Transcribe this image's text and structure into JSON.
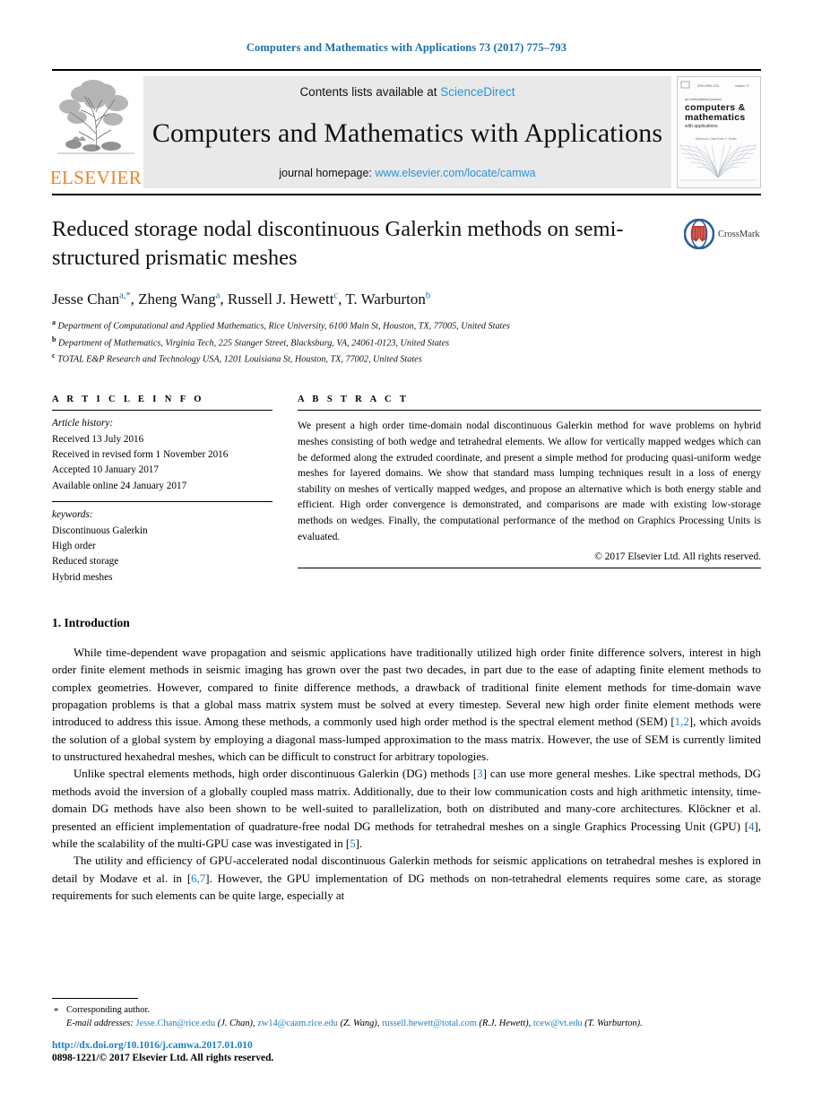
{
  "running_head": "Computers and Mathematics with Applications 73 (2017) 775–793",
  "masthead": {
    "publisher_name": "ELSEVIER",
    "contents_prefix": "Contents lists available at ",
    "contents_link": "ScienceDirect",
    "journal_title": "Computers and Mathematics with Applications",
    "homepage_prefix": "journal homepage: ",
    "homepage_url": "www.elsevier.com/locate/camwa",
    "cover": {
      "line1": "an international journal",
      "line2": "computers &",
      "line3": "mathematics",
      "line4": "with applications",
      "editors": "Editors-in-Chief  Ervin Y. Rodin"
    }
  },
  "article": {
    "title": "Reduced storage nodal discontinuous Galerkin methods on semi-structured prismatic meshes",
    "crossmark_label": "CrossMark",
    "authors": [
      {
        "name": "Jesse Chan",
        "marks": "a,*"
      },
      {
        "name": "Zheng Wang",
        "marks": "a"
      },
      {
        "name": "Russell J. Hewett",
        "marks": "c"
      },
      {
        "name": "T. Warburton",
        "marks": "b"
      }
    ],
    "affiliations": [
      {
        "mark": "a",
        "text": "Department of Computational and Applied Mathematics, Rice University, 6100 Main St, Houston, TX, 77005, United States"
      },
      {
        "mark": "b",
        "text": "Department of Mathematics, Virginia Tech, 225 Stanger Street, Blacksburg, VA, 24061-0123, United States"
      },
      {
        "mark": "c",
        "text": "TOTAL E&P Research and Technology USA, 1201 Louisiana St, Houston, TX, 77002, United States"
      }
    ]
  },
  "article_info": {
    "heading": "A R T I C L E   I N F O",
    "history_label": "Article history:",
    "history": [
      "Received 13 July 2016",
      "Received in revised form 1 November 2016",
      "Accepted 10 January 2017",
      "Available online 24 January 2017"
    ],
    "keywords_label": "keywords:",
    "keywords": [
      "Discontinuous Galerkin",
      "High order",
      "Reduced storage",
      "Hybrid meshes"
    ]
  },
  "abstract": {
    "heading": "A B S T R A C T",
    "text": "We present a high order time-domain nodal discontinuous Galerkin method for wave problems on hybrid meshes consisting of both wedge and tetrahedral elements. We allow for vertically mapped wedges which can be deformed along the extruded coordinate, and present a simple method for producing quasi-uniform wedge meshes for layered domains. We show that standard mass lumping techniques result in a loss of energy stability on meshes of vertically mapped wedges, and propose an alternative which is both energy stable and efficient. High order convergence is demonstrated, and comparisons are made with existing low-storage methods on wedges. Finally, the computational performance of the method on Graphics Processing Units is evaluated.",
    "copyright": "© 2017 Elsevier Ltd. All rights reserved."
  },
  "introduction": {
    "heading": "1. Introduction",
    "paragraph1_a": "While time-dependent wave propagation and seismic applications have traditionally utilized high order finite difference solvers, interest in high order finite element methods in seismic imaging has grown over the past two decades, in part due to the ease of adapting finite element methods to complex geometries. However, compared to finite difference methods, a drawback of traditional finite element methods for time-domain wave propagation problems is that a global mass matrix system must be solved at every timestep. Several new high order finite element methods were introduced to address this issue. Among these methods, a commonly used high order method is the spectral element method (SEM) [",
    "cite1": "1,2",
    "paragraph1_b": "], which avoids the solution of a global system by employing a diagonal mass-lumped approximation to the mass matrix. However, the use of SEM is currently limited to unstructured hexahedral meshes, which can be difficult to construct for arbitrary topologies.",
    "paragraph2_a": "Unlike spectral elements methods, high order discontinuous Galerkin (DG) methods [",
    "cite2": "3",
    "paragraph2_b": "] can use more general meshes. Like spectral methods, DG methods avoid the inversion of a globally coupled mass matrix. Additionally, due to their low communication costs and high arithmetic intensity, time-domain DG methods have also been shown to be well-suited to parallelization, both on distributed and many-core architectures. Klöckner et al. presented an efficient implementation of quadrature-free nodal DG methods for tetrahedral meshes on a single Graphics Processing Unit (GPU) [",
    "cite3": "4",
    "paragraph2_c": "], while the scalability of the multi-GPU case was investigated in [",
    "cite4": "5",
    "paragraph2_d": "].",
    "paragraph3_a": "The utility and efficiency of GPU-accelerated nodal discontinuous Galerkin methods for seismic applications on tetrahedral meshes is explored in detail by Modave et al. in [",
    "cite5": "6,7",
    "paragraph3_b": "]. However, the GPU implementation of DG methods on non-tetrahedral elements requires some care, as storage requirements for such elements can be quite large, especially at"
  },
  "footnotes": {
    "corresponding": "Corresponding author.",
    "email_label": "E-mail addresses:",
    "emails": [
      {
        "address": "Jesse.Chan@rice.edu",
        "owner": " (J. Chan), "
      },
      {
        "address": "zw14@caam.rice.edu",
        "owner": " (Z. Wang), "
      },
      {
        "address": "russell.hewett@total.com",
        "owner": " (R.J. Hewett), "
      },
      {
        "address": "tcew@vt.edu",
        "owner": " (T. Warburton)."
      }
    ],
    "doi": "http://dx.doi.org/10.1016/j.camwa.2017.01.010",
    "issn": "0898-1221/© 2017 Elsevier Ltd. All rights reserved."
  },
  "colors": {
    "link_blue": "#1a7fc1",
    "header_blue": "#1a6ea8",
    "elsevier_orange": "#F08221",
    "masthead_gray": "#e9e9e9"
  }
}
